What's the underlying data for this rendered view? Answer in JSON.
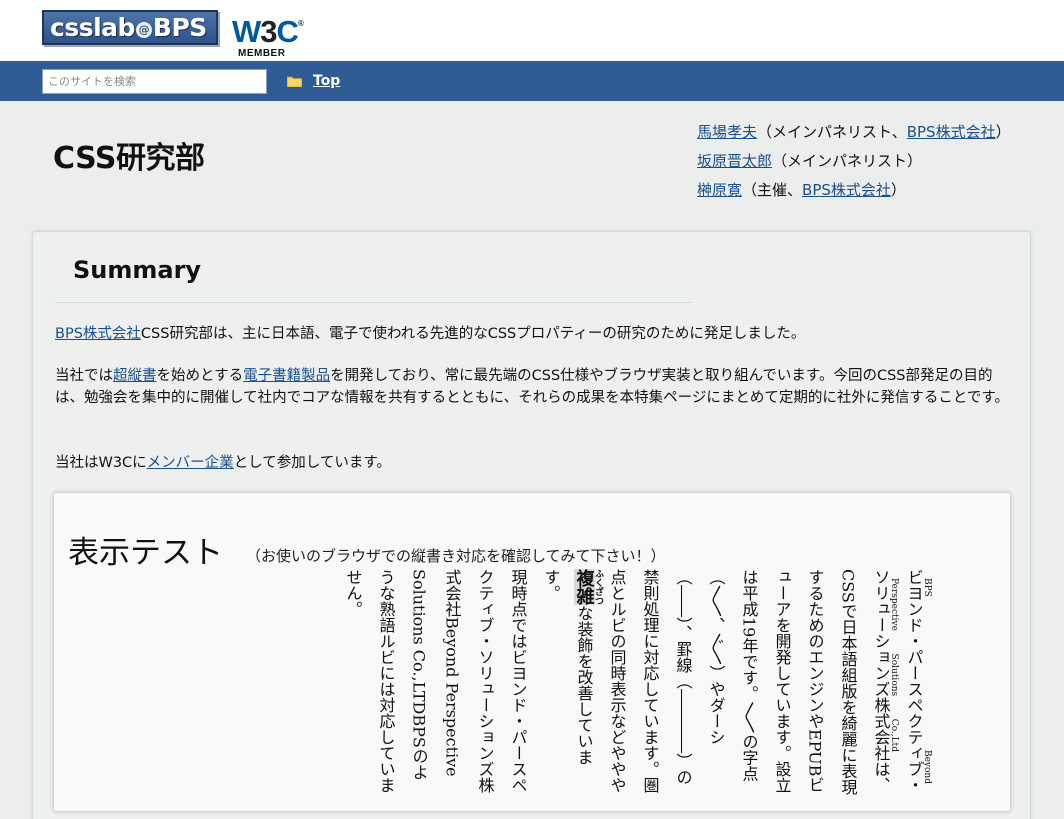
{
  "header": {
    "logo_text_left": "csslab",
    "logo_text_at": "@",
    "logo_text_right": "BPS",
    "w3c_mark_w": "W",
    "w3c_mark_3": "3",
    "w3c_mark_c": "C",
    "w3c_registered": "®",
    "w3c_member": "MEMBER"
  },
  "nav": {
    "search_placeholder": "このサイトを検索",
    "top_label": "Top"
  },
  "page": {
    "title": "CSS研究部"
  },
  "members": [
    {
      "name": "馬場孝夫",
      "mid": "（メインパネリスト、",
      "org": "BPS株式会社",
      "end": "）"
    },
    {
      "name": "坂原晋太郎",
      "mid": "（メインパネリスト）",
      "org": "",
      "end": ""
    },
    {
      "name": "榊原寛",
      "mid": "（主催、",
      "org": "BPS株式会社",
      "end": "）"
    }
  ],
  "summary": {
    "title": "Summary",
    "p1_link": "BPS株式会社",
    "p1_text": "CSS研究部は、主に日本語、電子で使われる先進的なCSSプロパティーの研究のために発足しました。",
    "p2_a": "当社では",
    "p2_link1": "超縦書",
    "p2_b": "を始めとする",
    "p2_link2": "電子書籍製品",
    "p2_c": "を開発しており、常に最先端のCSS仕様やブラウザ実装と取り組んでいます。今回のCSS部発足の目的は、勉強会を集中的に開催して社内でコアな情報を共有するとともに、それらの成果を本特集ページにまとめて定期的に社外に発信することです。",
    "p3_a": "当社はW3Cに",
    "p3_link": "メンバー企業",
    "p3_b": "として参加しています。"
  },
  "test": {
    "title": "表示テスト",
    "note": "（お使いのブラウザでの縦書き対応を確認してみて下さい！）",
    "v1_ruby_base": "ビヨンド・パースペクティブ・ソリューションズ株式会社",
    "v1_ruby_text": "BPS Beyond Perspective Solutions Co.,Ltd",
    "v1_a": "は、CSSで日本語組版を綺麗に表現するためのエンジンやEPUBビューアを開発しています。設立は平成19年です。〳〵の字点（〳〵、〴〵）やダーシ（――）、罫線（――――）の禁則処理に対応しています。圏点とルビの同時表示などややや",
    "v1_ruby2_base": "複雑",
    "v1_ruby2_text": "ふくざつ",
    "v1_b": "な装飾を改善しています。",
    "v2": "現時点ではビヨンド・パースペクティブ・ソリューションズ株式会社Beyond Perspective Solutions Co.,LTDBPSのような熟語ルビには対応していません。"
  }
}
